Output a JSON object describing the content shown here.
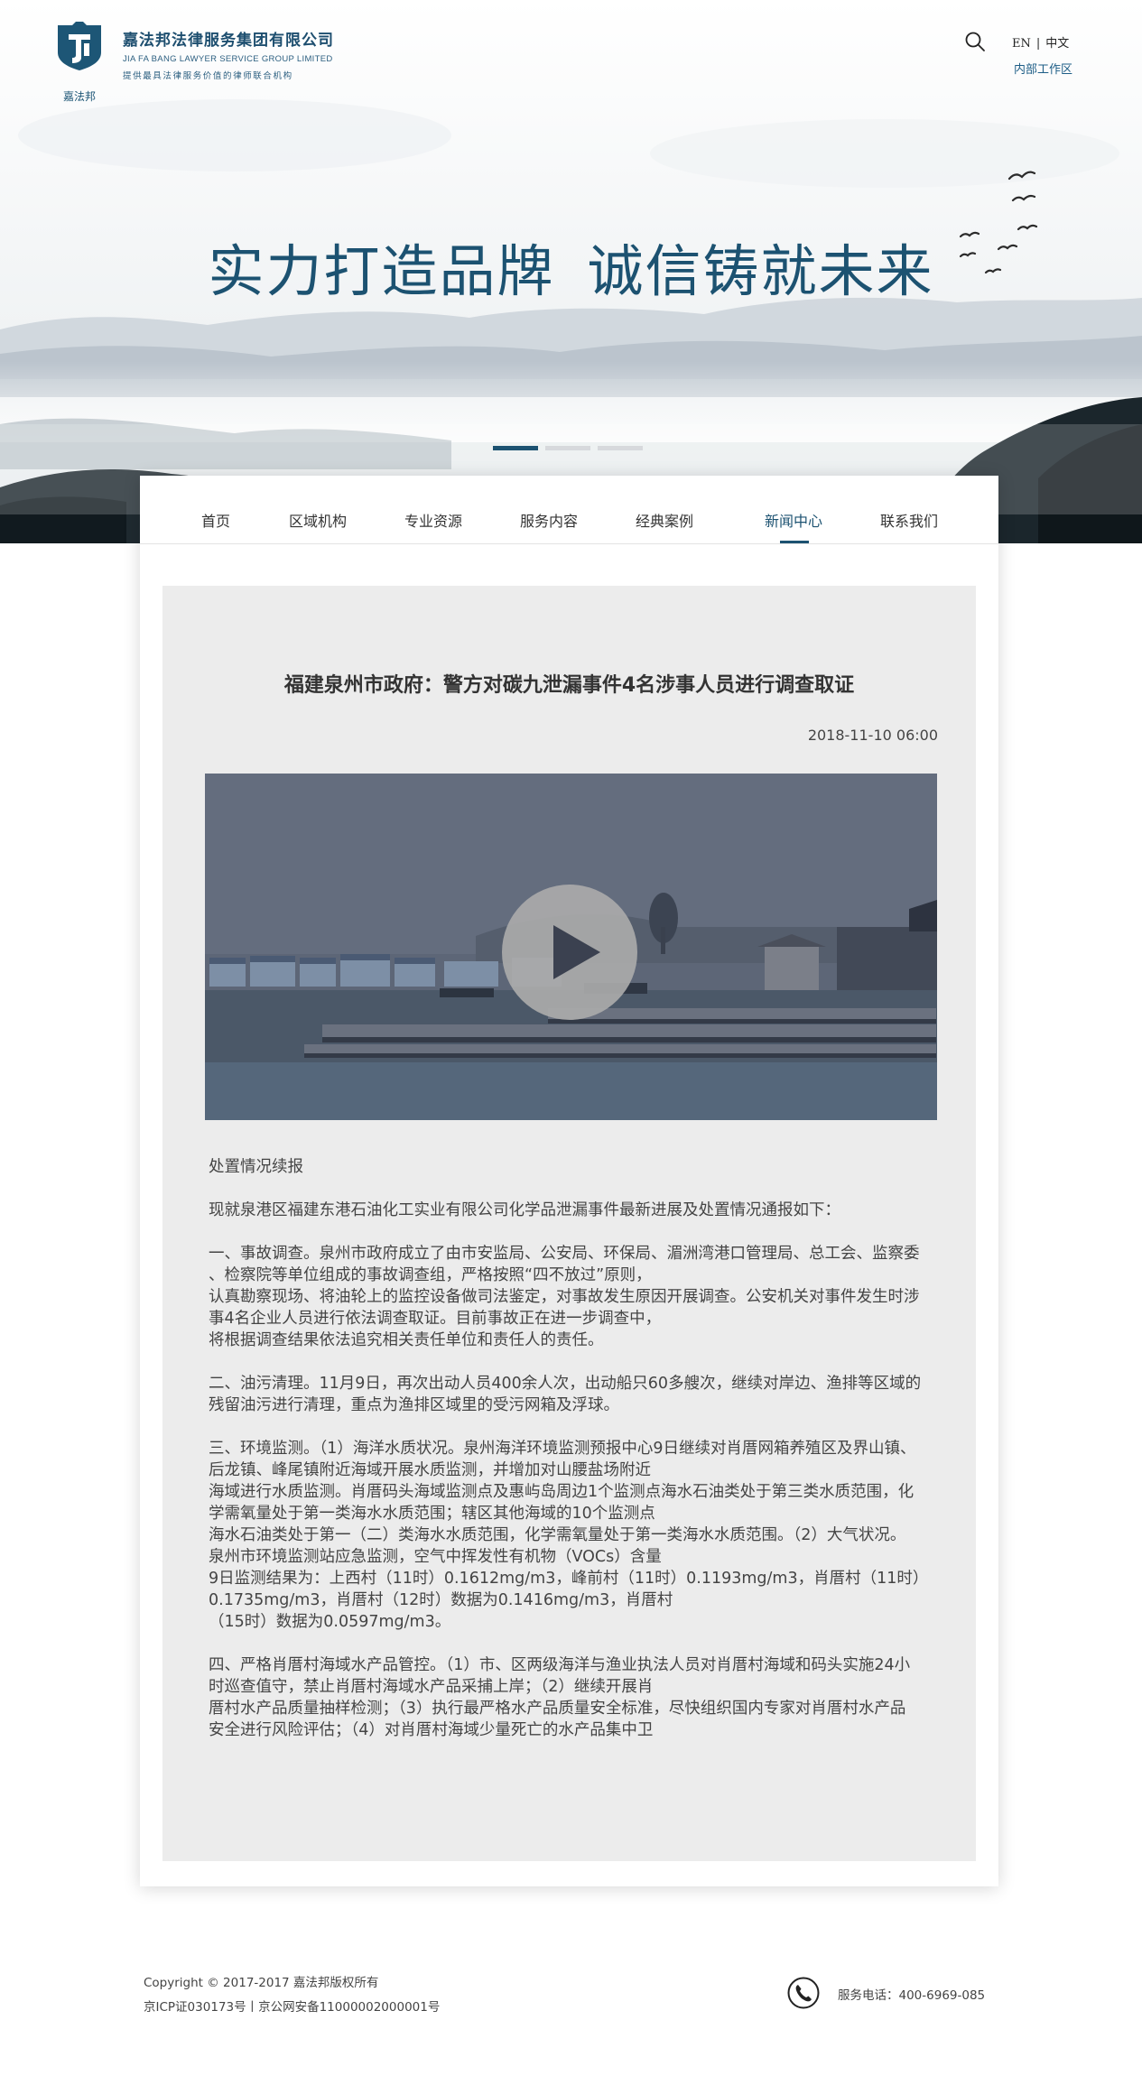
{
  "header": {
    "logo_caption": "嘉法邦",
    "company_cn": "嘉法邦法律服务集团有限公司",
    "company_en": "JIA FA BANG LAWYER SERVICE GROUP LIMITED",
    "slogan": "提供最具法律服务价值的律师联合机构",
    "lang_en": "EN",
    "lang_sep": "|",
    "lang_cn": "中文",
    "internal_link": "内部工作区",
    "search_icon": "search-icon"
  },
  "banner": {
    "slogan_part1": "实力打造品牌",
    "slogan_part2": "诚信铸就未来",
    "active_slide": 1,
    "slide_count": 3
  },
  "nav": {
    "items": [
      {
        "label": "首页"
      },
      {
        "label": "区域机构"
      },
      {
        "label": "专业资源"
      },
      {
        "label": "服务内容"
      },
      {
        "label": "经典案例"
      },
      {
        "label": "新闻中心"
      },
      {
        "label": "联系我们"
      }
    ],
    "active_index": 5
  },
  "article": {
    "title": "福建泉州市政府：警方对碳九泄漏事件4名涉事人员进行调查取证",
    "date": "2018-11-10 06:00",
    "video_icon": "play-icon",
    "paragraphs": [
      {
        "lines": [
          "处置情况续报"
        ]
      },
      {
        "lines": [
          "现就泉港区福建东港石油化工实业有限公司化学品泄漏事件最新进展及处置情况通报如下："
        ]
      },
      {
        "lines": [
          "一、事故调查。泉州市政府成立了由市安监局、公安局、环保局、湄洲湾港口管理局、总工会、监察委",
          "、检察院等单位组成的事故调查组，严格按照“四不放过”原则，",
          "认真勘察现场、将油轮上的监控设备做司法鉴定，对事故发生原因开展调查。公安机关对事件发生时涉",
          "事4名企业人员进行依法调查取证。目前事故正在进一步调查中，",
          "将根据调查结果依法追究相关责任单位和责任人的责任。"
        ]
      },
      {
        "lines": [
          "二、油污清理。11月9日，再次出动人员400余人次，出动船只60多艘次，继续对岸边、渔排等区域的",
          "残留油污进行清理，重点为渔排区域里的受污网箱及浮球。"
        ]
      },
      {
        "lines": [
          "三、环境监测。（1）海洋水质状况。泉州海洋环境监测预报中心9日继续对肖厝网箱养殖区及界山镇、",
          "后龙镇、峰尾镇附近海域开展水质监测，并增加对山腰盐场附近",
          "海域进行水质监测。肖厝码头海域监测点及惠屿岛周边1个监测点海水石油类处于第三类水质范围，化",
          "学需氧量处于第一类海水水质范围；辖区其他海域的10个监测点",
          "海水石油类处于第一（二）类海水水质范围，化学需氧量处于第一类海水水质范围。（2）大气状况。",
          "泉州市环境监测站应急监测，空气中挥发性有机物（VOCs）含量",
          "9日监测结果为：上西村（11时）0.1612mg/m3，峰前村（11时）0.1193mg/m3，肖厝村（11时）",
          "0.1735mg/m3，肖厝村（12时）数据为0.1416mg/m3，肖厝村",
          "（15时）数据为0.0597mg/m3。"
        ]
      },
      {
        "lines": [
          "四、严格肖厝村海域水产品管控。（1）市、区两级海洋与渔业执法人员对肖厝村海域和码头实施24小",
          "时巡查值守，禁止肖厝村海域水产品采捕上岸；（2）继续开展肖",
          "厝村水产品质量抽样检测；（3）执行最严格水产品质量安全标准，尽快组织国内专家对肖厝村水产品",
          "安全进行风险评估；（4）对肖厝村海域少量死亡的水产品集中卫"
        ]
      }
    ]
  },
  "footer": {
    "copyright": "Copyright © 2017-2017 嘉法邦版权所有",
    "icp": "京ICP证030173号丨京公网安备11000002000001号",
    "phone": "服务电话：400-6969-085",
    "phone_icon": "phone-icon"
  },
  "colors": {
    "brand": "#1c5271",
    "link": "#1d5d86",
    "article_bg": "#ececec"
  }
}
